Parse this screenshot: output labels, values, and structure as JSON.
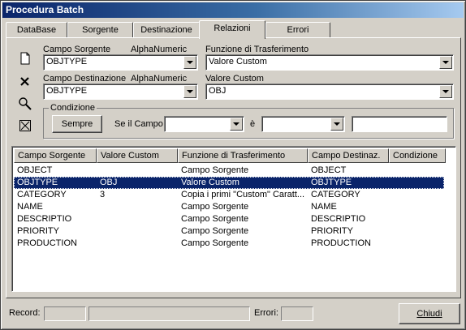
{
  "window": {
    "title": "Procedura Batch"
  },
  "tabs": [
    {
      "label": "DataBase"
    },
    {
      "label": "Sorgente"
    },
    {
      "label": "Destinazione"
    },
    {
      "label": "Relazioni"
    },
    {
      "label": "Errori"
    }
  ],
  "active_tab": "Relazioni",
  "form": {
    "source_field_label": "Campo Sorgente",
    "source_field_type": "AlphaNumeric",
    "source_field_value": "OBJTYPE",
    "transfer_function_label": "Funzione di Trasferimento",
    "transfer_function_value": "Valore Custom",
    "dest_field_label": "Campo Destinazione",
    "dest_field_type": "AlphaNumeric",
    "dest_field_value": "OBJTYPE",
    "custom_value_label": "Valore Custom",
    "custom_value_value": "OBJ",
    "condition": {
      "group_label": "Condizione",
      "always_button": "Sempre",
      "if_field_label": "Se il Campo",
      "if_field_value": "",
      "is_label": "è",
      "operator_value": "",
      "compare_value": ""
    }
  },
  "toolbar": {
    "new_icon": "new-document-icon",
    "delete_icon": "delete-x-icon",
    "search_icon": "magnifier-icon",
    "clear_icon": "box-x-icon"
  },
  "table": {
    "columns": [
      "Campo Sorgente",
      "Valore Custom",
      "Funzione di Trasferimento",
      "Campo Destinaz.",
      "Condizione"
    ],
    "rows": [
      [
        "OBJECT",
        "",
        "Campo Sorgente",
        "OBJECT",
        ""
      ],
      [
        "OBJTYPE",
        "OBJ",
        "Valore Custom",
        "OBJTYPE",
        ""
      ],
      [
        "CATEGORY",
        "3",
        "Copia i primi \"Custom\" Caratt...",
        "CATEGORY",
        ""
      ],
      [
        "NAME",
        "",
        "Campo Sorgente",
        "NAME",
        ""
      ],
      [
        "DESCRIPTIO",
        "",
        "Campo Sorgente",
        "DESCRIPTIO",
        ""
      ],
      [
        "PRIORITY",
        "",
        "Campo Sorgente",
        "PRIORITY",
        ""
      ],
      [
        "PRODUCTION",
        "",
        "Campo Sorgente",
        "PRODUCTION",
        ""
      ]
    ],
    "selected_row_index": 1
  },
  "status": {
    "record_label": "Record:",
    "record_value": "",
    "record_info": "",
    "errors_label": "Errori:",
    "errors_value": "",
    "close_button": "Chiudi"
  },
  "colors": {
    "face": "#d4d0c8",
    "title_start": "#0a246a",
    "title_end": "#a6caf0",
    "selection": "#0a246a"
  }
}
